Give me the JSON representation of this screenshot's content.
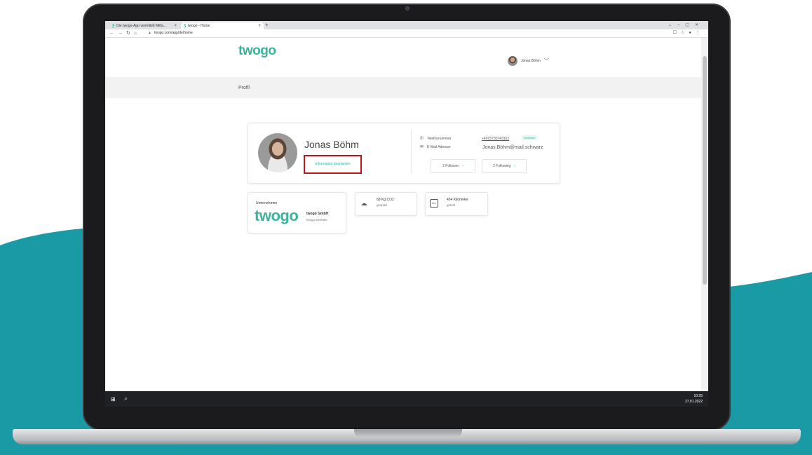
{
  "browser": {
    "tabs": [
      {
        "favicon": "twogo-icon",
        "title": "Die twogo-App vermittelt Mitfa..."
      },
      {
        "favicon": "twogo-icon",
        "title": "twogo - Home"
      }
    ],
    "new_tab": "+",
    "url": "twogo.com/app/de/home"
  },
  "header": {
    "logo": "twogo",
    "user_name": "Jonas Böhm"
  },
  "section": {
    "title": "Profil"
  },
  "profile": {
    "name": "Jonas Böhm",
    "edit_link": "Information bearbeiten",
    "phone_label": "Telefonnummer",
    "phone_value": "+4915730743163",
    "verified_badge": "Verifiziert",
    "email_label": "E-Mail Adresse",
    "email_value": "Jonas.Böhm@mail.schwarz",
    "follower_label": "2 Follower",
    "following_label": "2 Following"
  },
  "company": {
    "label": "Unternehmen",
    "logo": "twogo",
    "name": "twogo GmbH",
    "sub": "twogo Zentrale"
  },
  "stats": [
    {
      "icon": "co2-cloud-icon",
      "value": "68 Kg CO2",
      "sub": "gespart"
    },
    {
      "icon": "km-icon",
      "value": "454 Kilometer",
      "sub": "geteilt",
      "icon_text": "km"
    }
  ],
  "taskbar": {
    "time": "10:25",
    "date": "27.01.2022"
  },
  "colors": {
    "brand": "#3cb39c",
    "highlight_box": "#c0141b",
    "background_wave": "#1a9aa5"
  }
}
